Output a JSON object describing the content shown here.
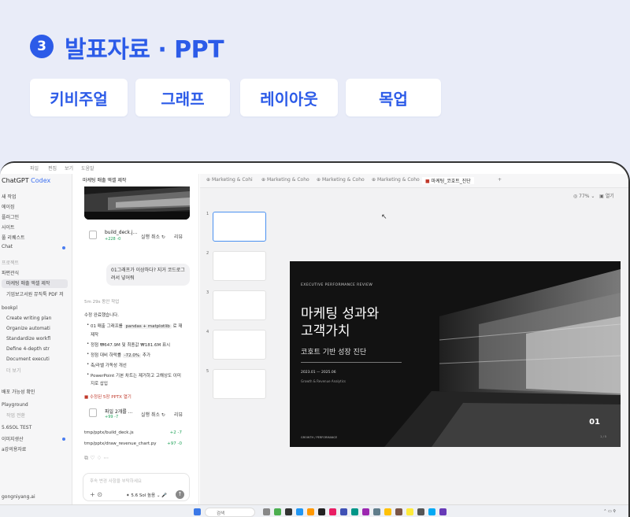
{
  "header": {
    "step": "3",
    "title": "발표자료 · PPT",
    "tags": [
      "키비주얼",
      "그래프",
      "레이아웃",
      "목업"
    ]
  },
  "menubar": [
    "파일",
    "편집",
    "보기",
    "도움말"
  ],
  "sidebar": {
    "brand": "ChatGPT",
    "brand_accent": "Codex",
    "items": [
      "새 작업",
      "에이징",
      "플러그인",
      "사이트",
      "풀 리퀘스트",
      "Chat"
    ],
    "section_projects": "프로젝트",
    "project": "파편관식",
    "project_items": [
      "마케팅 매출 액셀 제작",
      "기업보고서원 뮤직툭 PDF 저"
    ],
    "group_label": "bookpl",
    "group_items": [
      "Create writing plan",
      "Organize automati",
      "Standardize workfl",
      "Define 4-depth str",
      "Document executi"
    ],
    "more": "더 보기",
    "more_items": [
      "배포 가능성 확인",
      "Playground",
      "작업 전환",
      "5.6SOL TEST",
      "이미지생산",
      "a강의용자료"
    ],
    "user": "gongniyang.ai"
  },
  "chat": {
    "title": "마케팅 매출 액셀 제작",
    "card1": {
      "name": "build_deck.j...",
      "diff": "+228 -0",
      "undo": "실행 취소 ↻",
      "review": "리뷰"
    },
    "bubble": "01그래프가 이상하다? 지거 코드로그 려서 넣어줘",
    "worked": "5m 29s 동안 작업",
    "intro": "수정 완료했습니다.",
    "bullets": [
      {
        "pre": "01 매출 그래프를 ",
        "code": "pandas + matplotlib",
        "post": " 로 재"
      },
      {
        "pre": "제작",
        "code": "",
        "post": ""
      },
      {
        "pre": "정점 ₩647.9M 및 최종값 ₩181.6M 표시",
        "code": "",
        "post": ""
      },
      {
        "pre": "정점 대비 하락률 ",
        "code": "-72.0%",
        "post": " 추가"
      },
      {
        "pre": "축/라벨 가독성 개선",
        "code": "",
        "post": ""
      },
      {
        "pre": "PowerPoint 기본 차트는 제거하고 고해상도 이미",
        "code": "",
        "post": ""
      },
      {
        "pre": "지로 삽입",
        "code": "",
        "post": ""
      }
    ],
    "open_link": "수정된 5장 PPTX 열기",
    "card2": {
      "name": "파일 2개를 ...",
      "diff": "+99 -7",
      "undo": "실행 취소 ↻",
      "review": "리뷰"
    },
    "files": [
      {
        "path": "tmp/pptx/build_deck.js",
        "diff": "+2 -7"
      },
      {
        "path": "tmp/pptx/draw_revenue_chart.py",
        "diff": "+97 -0"
      }
    ],
    "placeholder": "후속 변경 사항을 부탁하세요",
    "model": "5.6 Sol 높음"
  },
  "tabs": [
    "Marketing & Cohi",
    "Marketing & Coho",
    "Marketing & Coho",
    "Marketing & Coho",
    "마케팅_코호트_진단"
  ],
  "viewer": {
    "zoom": "77%",
    "open": "열기",
    "thumbs": [
      "1",
      "2",
      "3",
      "4",
      "5"
    ],
    "slide": {
      "eyebrow": "EXECUTIVE PERFORMANCE REVIEW",
      "title1": "마케팅 성과와",
      "title2": "고객가치",
      "subtitle": "코호트 기반 성장 진단",
      "date": "2023.01 — 2025.06",
      "dept": "Growth & Revenue Analytics",
      "footer": "GROWTH / PERFORMANCE",
      "number": "01",
      "page": "1 / 5"
    }
  },
  "taskbar": {
    "search": "검색"
  }
}
